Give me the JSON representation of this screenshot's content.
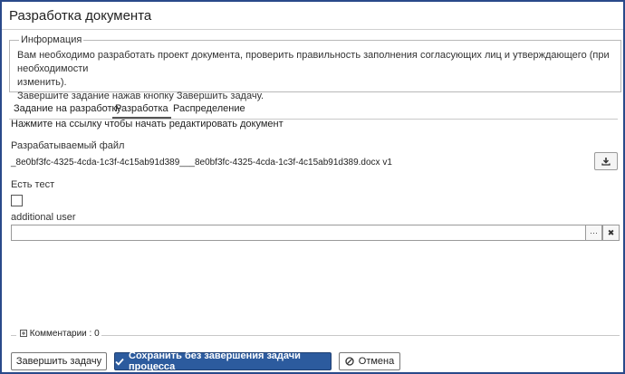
{
  "window": {
    "title": "Разработка документа"
  },
  "info": {
    "legend": "Информация",
    "line1": "Вам необходимо разработать проект документа, проверить правильность заполнения согласующих лиц и утверждающего (при необходимости",
    "line2": "изменить).",
    "line3": "Завершите задание нажав кнопку Завершить задачу."
  },
  "tabs": [
    {
      "label": "Задание на разработку"
    },
    {
      "label": "Разработка",
      "active": true
    },
    {
      "label": "Распределение"
    }
  ],
  "hint": "Нажмите на ссылку чтобы начать редактировать документ",
  "file": {
    "label": "Разрабатываемый файл",
    "name": "_8e0bf3fc-4325-4cda-1c3f-4c15ab91d389___8e0bf3fc-4325-4cda-1c3f-4c15ab91d389.docx  v1",
    "download_icon": "download-icon"
  },
  "test_field": {
    "label": "Есть тест",
    "checked": false
  },
  "additional_user": {
    "label": "additional user",
    "value": "",
    "browse_label": "···",
    "clear_label": "✖"
  },
  "comments": {
    "label": "Комментарии : 0",
    "toggle_icon": "plus-square-icon"
  },
  "buttons": {
    "complete": "Завершить задачу",
    "save": "Сохранить без завершения задачи процесса",
    "cancel": "Отмена"
  },
  "colors": {
    "frame": "#2a4a8a",
    "primary": "#2c5b9e"
  }
}
